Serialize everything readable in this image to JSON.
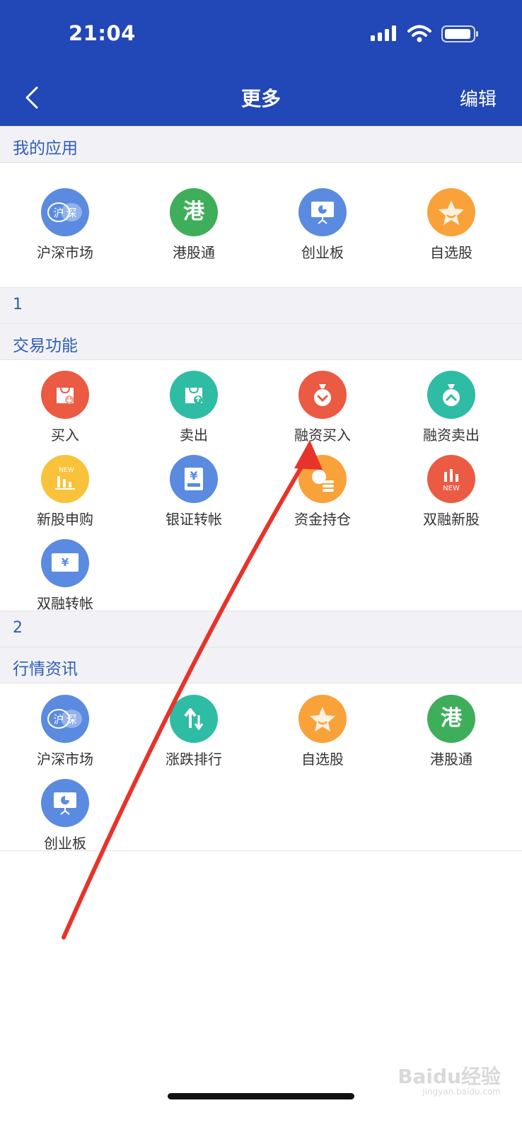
{
  "status": {
    "time": "21:04"
  },
  "nav": {
    "title": "更多",
    "edit_label": "编辑"
  },
  "sections": {
    "my_apps": {
      "title": "我的应用",
      "items": [
        "沪深市场",
        "港股通",
        "创业板",
        "自选股"
      ]
    },
    "group1": {
      "number": "1"
    },
    "trading": {
      "title": "交易功能",
      "items": [
        "买入",
        "卖出",
        "融资买入",
        "融资卖出",
        "新股申购",
        "银证转帐",
        "资金持仓",
        "双融新股",
        "双融转帐"
      ]
    },
    "group2": {
      "number": "2"
    },
    "market": {
      "title": "行情资讯",
      "items": [
        "沪深市场",
        "涨跌排行",
        "自选股",
        "港股通",
        "创业板"
      ]
    }
  },
  "icons": {
    "hushen_badge": "沪",
    "hushen_badge2": "深",
    "hk_glyph": "港",
    "new_badge": "NEW",
    "yen_glyph": "¥"
  },
  "watermark": {
    "brand": "Baidu经验",
    "url": "jingyan.baidu.com"
  },
  "colors": {
    "header": "#2247b6",
    "section_text": "#2f5db8",
    "arrow": "#e8332a"
  }
}
